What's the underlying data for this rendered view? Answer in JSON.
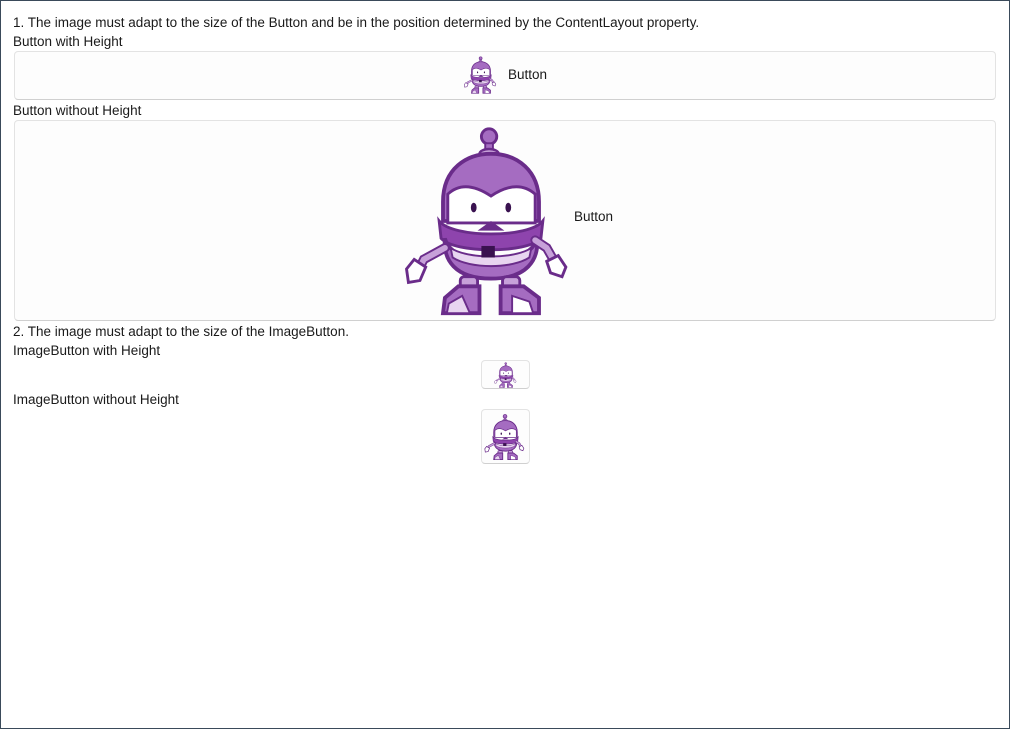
{
  "section1": {
    "heading": "1. The image must adapt to the size of the Button and be in the position determined by the ContentLayout property.",
    "with_height_label": "Button with Height",
    "with_height_button_text": "Button",
    "without_height_label": "Button without Height",
    "without_height_button_text": "Button"
  },
  "section2": {
    "heading": "2. The image must adapt to the size of the ImageButton.",
    "with_height_label": "ImageButton with Height",
    "without_height_label": "ImageButton without Height"
  },
  "icons": {
    "image": "dotnet-bot-robot-icon"
  },
  "colors": {
    "robot_purple": "#9b59b6",
    "robot_dark": "#6a2c8a",
    "robot_light": "#e8d5f0",
    "border": "#3a4a5a"
  }
}
